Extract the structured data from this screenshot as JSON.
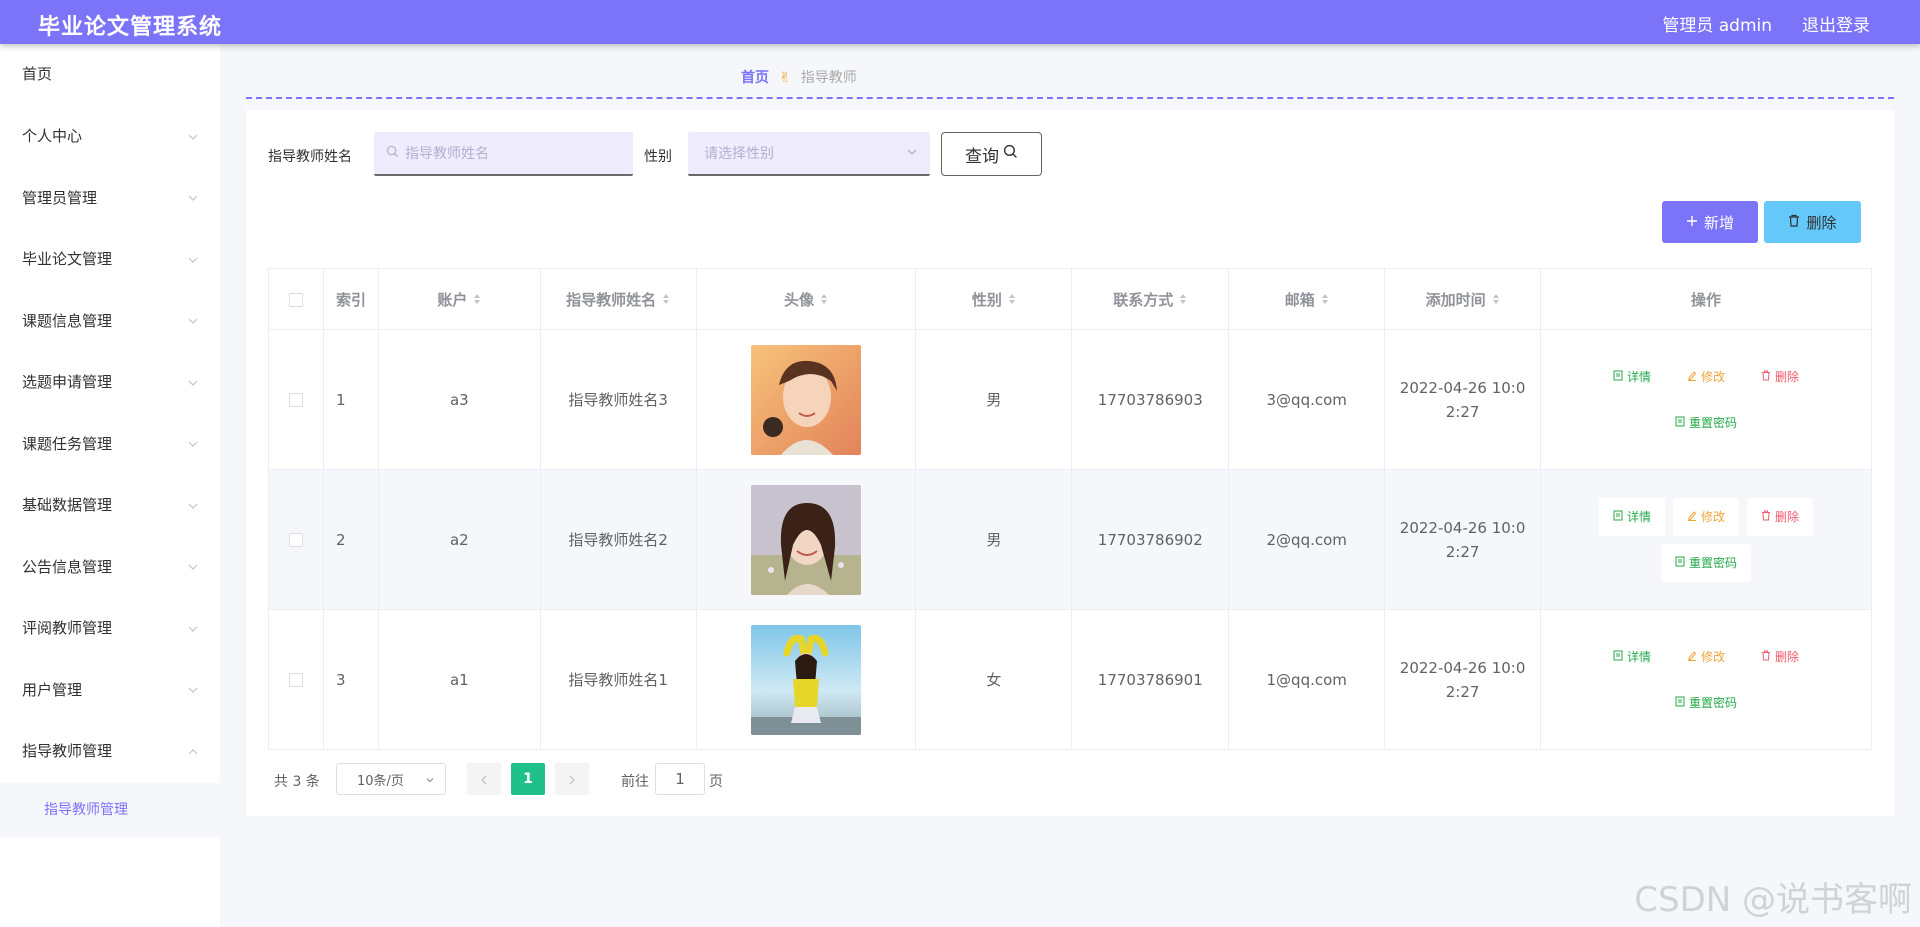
{
  "header": {
    "title": "毕业论文管理系统",
    "user": "管理员 admin",
    "logout": "退出登录"
  },
  "sidebar": {
    "items": [
      {
        "label": "首页"
      },
      {
        "label": "个人中心"
      },
      {
        "label": "管理员管理"
      },
      {
        "label": "毕业论文管理"
      },
      {
        "label": "课题信息管理"
      },
      {
        "label": "选题申请管理"
      },
      {
        "label": "课题任务管理"
      },
      {
        "label": "基础数据管理"
      },
      {
        "label": "公告信息管理"
      },
      {
        "label": "评阅教师管理"
      },
      {
        "label": "用户管理"
      },
      {
        "label": "指导教师管理"
      }
    ],
    "active_sub": "指导教师管理"
  },
  "breadcrumb": {
    "home": "首页",
    "sep": "✌",
    "current": "指导教师"
  },
  "search": {
    "name_label": "指导教师姓名",
    "name_placeholder": "指导教师姓名",
    "gender_label": "性别",
    "gender_placeholder": "请选择性别",
    "query_button": "查询"
  },
  "actions": {
    "add": "新增",
    "delete": "删除"
  },
  "table": {
    "headers": [
      "索引",
      "账户",
      "指导教师姓名",
      "头像",
      "性别",
      "联系方式",
      "邮箱",
      "添加时间",
      "操作"
    ],
    "rows": [
      {
        "index": "1",
        "account": "a3",
        "name": "指导教师姓名3",
        "gender": "男",
        "phone": "17703786903",
        "email": "3@qq.com",
        "time_line1": "2022-04-26 10:0",
        "time_line2": "2:27"
      },
      {
        "index": "2",
        "account": "a2",
        "name": "指导教师姓名2",
        "gender": "男",
        "phone": "17703786902",
        "email": "2@qq.com",
        "time_line1": "2022-04-26 10:0",
        "time_line2": "2:27"
      },
      {
        "index": "3",
        "account": "a1",
        "name": "指导教师姓名1",
        "gender": "女",
        "phone": "17703786901",
        "email": "1@qq.com",
        "time_line1": "2022-04-26 10:0",
        "time_line2": "2:27"
      }
    ],
    "ops": {
      "detail": "详情",
      "edit": "修改",
      "remove": "删除",
      "reset": "重置密码"
    }
  },
  "pagination": {
    "total": "共 3 条",
    "page_size": "10条/页",
    "current_page": "1",
    "goto_label": "前往",
    "goto_value": "1",
    "page_suffix": "页"
  },
  "watermark": "CSDN @说书客啊",
  "colors": {
    "primary": "#7b73f8",
    "info": "#64c8fa",
    "success": "#25a94a",
    "warning": "#f0a43a",
    "danger": "#f0596b",
    "pager_active": "#20c08a"
  }
}
